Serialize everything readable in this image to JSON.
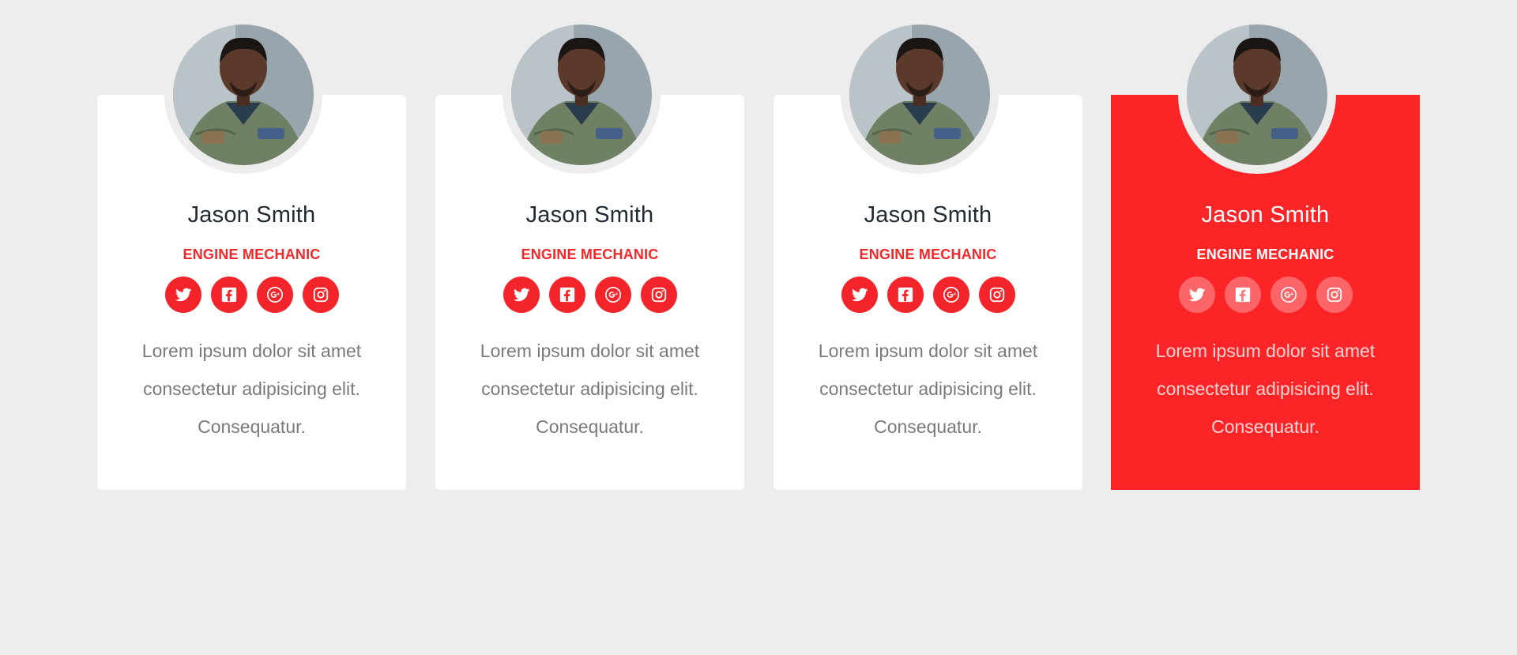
{
  "colors": {
    "page_background": "#ededed",
    "card_background": "#ffffff",
    "accent_red": "#fb2527",
    "name_text": "#1f2a33",
    "body_text": "#7a7a7a"
  },
  "team": {
    "members": [
      {
        "name": "Jason Smith",
        "role": "ENGINE MECHANIC",
        "bio": "Lorem ipsum dolor sit amet consectetur adipisicing elit. Consequatur.",
        "avatar": "portrait-photo",
        "socials": [
          "twitter-icon",
          "facebook-icon",
          "google-plus-icon",
          "instagram-icon"
        ],
        "highlighted": false
      },
      {
        "name": "Jason Smith",
        "role": "ENGINE MECHANIC",
        "bio": "Lorem ipsum dolor sit amet consectetur adipisicing elit. Consequatur.",
        "avatar": "portrait-photo",
        "socials": [
          "twitter-icon",
          "facebook-icon",
          "google-plus-icon",
          "instagram-icon"
        ],
        "highlighted": false
      },
      {
        "name": "Jason Smith",
        "role": "ENGINE MECHANIC",
        "bio": "Lorem ipsum dolor sit amet consectetur adipisicing elit. Consequatur.",
        "avatar": "portrait-photo",
        "socials": [
          "twitter-icon",
          "facebook-icon",
          "google-plus-icon",
          "instagram-icon"
        ],
        "highlighted": false
      },
      {
        "name": "Jason Smith",
        "role": "ENGINE MECHANIC",
        "bio": "Lorem ipsum dolor sit amet consectetur adipisicing elit. Consequatur.",
        "avatar": "portrait-photo",
        "socials": [
          "twitter-icon",
          "facebook-icon",
          "google-plus-icon",
          "instagram-icon"
        ],
        "highlighted": true
      }
    ]
  }
}
